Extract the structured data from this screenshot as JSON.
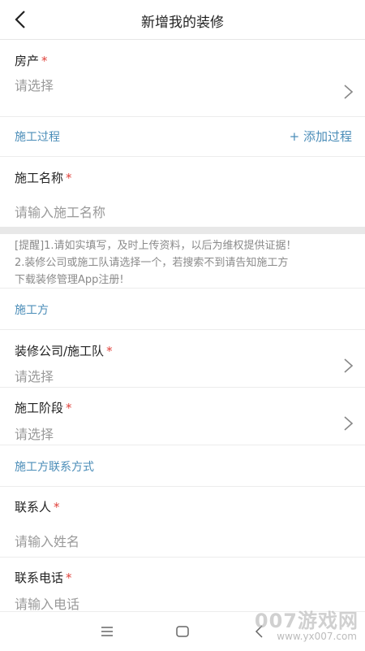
{
  "header": {
    "title": "新增我的装修"
  },
  "property": {
    "label": "房产",
    "required": "*",
    "placeholder": "请选择"
  },
  "process": {
    "section_title": "施工过程",
    "add_label": "+ 添加过程"
  },
  "construction_name": {
    "label": "施工名称",
    "required": "*",
    "placeholder": "请输入施工名称"
  },
  "notice": {
    "line1": "[提醒]1.请如实填写，及时上传资料，以后为维权提供证据！",
    "line2": "2.装修公司或施工队请选择一个，若搜索不到请告知施工方",
    "line3": "下载装修管理App注册!"
  },
  "contractor_section": {
    "title": "施工方"
  },
  "company": {
    "label": "装修公司/施工队",
    "required": "*",
    "placeholder": "请选择"
  },
  "stage": {
    "label": "施工阶段",
    "required": "*",
    "placeholder": "请选择"
  },
  "contact_section": {
    "title": "施工方联系方式"
  },
  "contact_person": {
    "label": "联系人",
    "required": "*",
    "placeholder": "请输入姓名"
  },
  "contact_phone": {
    "label": "联系电话",
    "required": "*",
    "placeholder": "请输入电话"
  },
  "watermark": {
    "text": "007游戏网",
    "url": "www.yx007.com"
  },
  "colors": {
    "accent": "#4b8db8",
    "required": "#e0413b",
    "placeholder": "#9a9a9a"
  }
}
